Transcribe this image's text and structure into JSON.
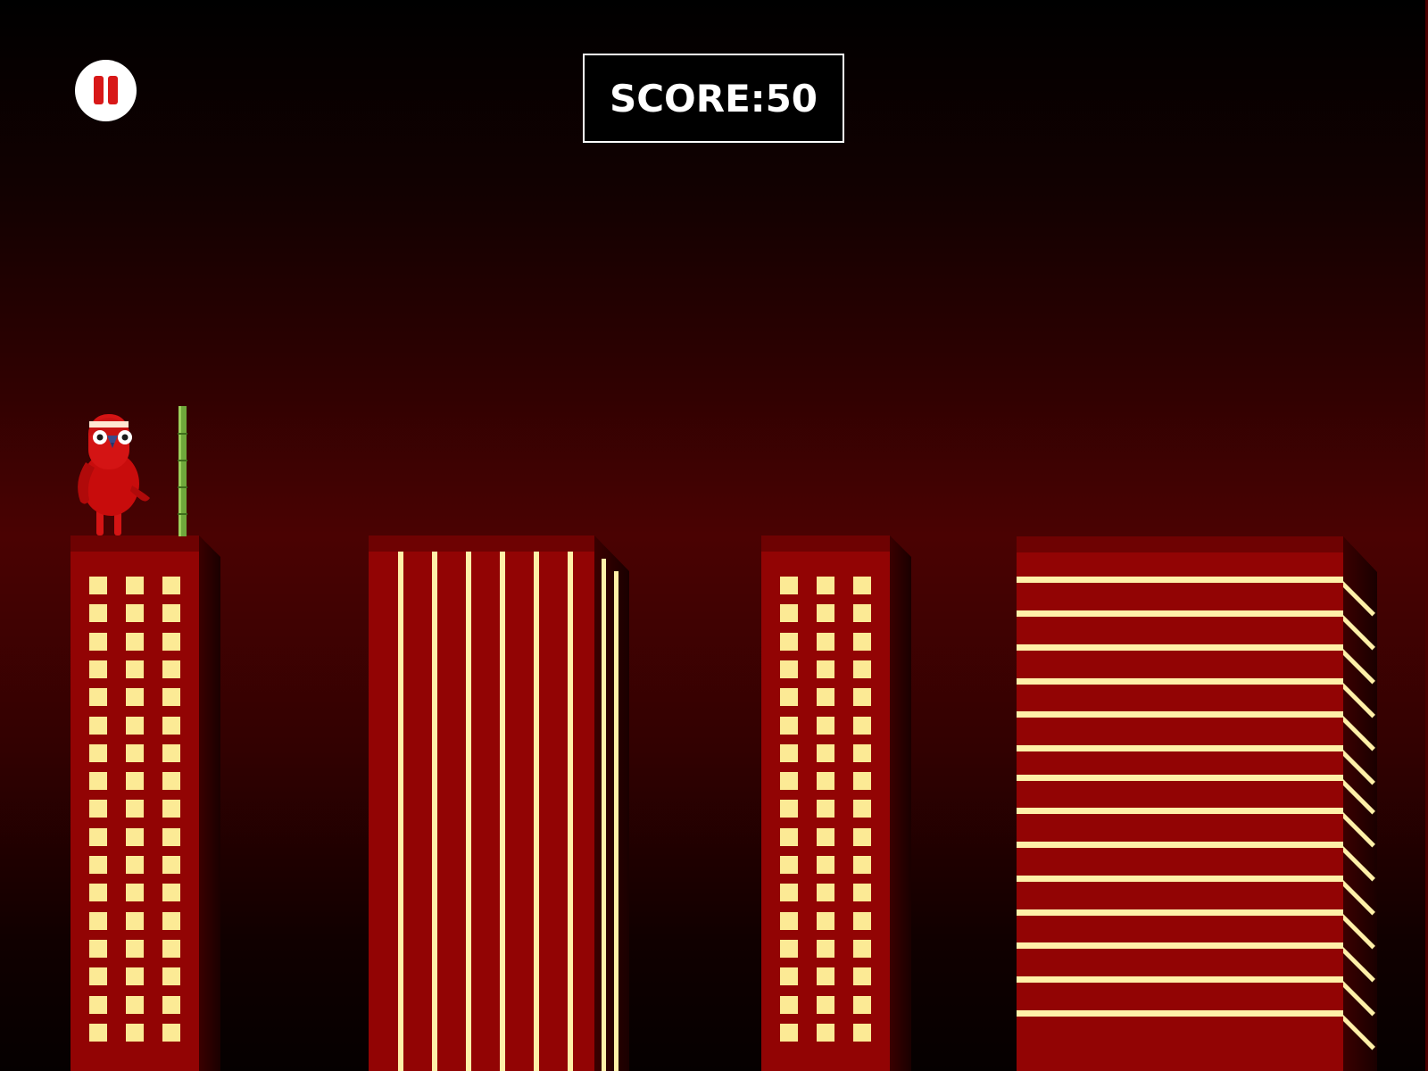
{
  "hud": {
    "score_label": "SCORE:",
    "score_value": "50",
    "pause_icon": "pause-icon"
  },
  "colors": {
    "building_red": "#920404",
    "window_yellow": "#fcea95",
    "pause_red": "#d81818",
    "bamboo_green": "#6fa83b"
  },
  "scene": {
    "player": "red-parrot-character",
    "pole": "bamboo-pole"
  }
}
